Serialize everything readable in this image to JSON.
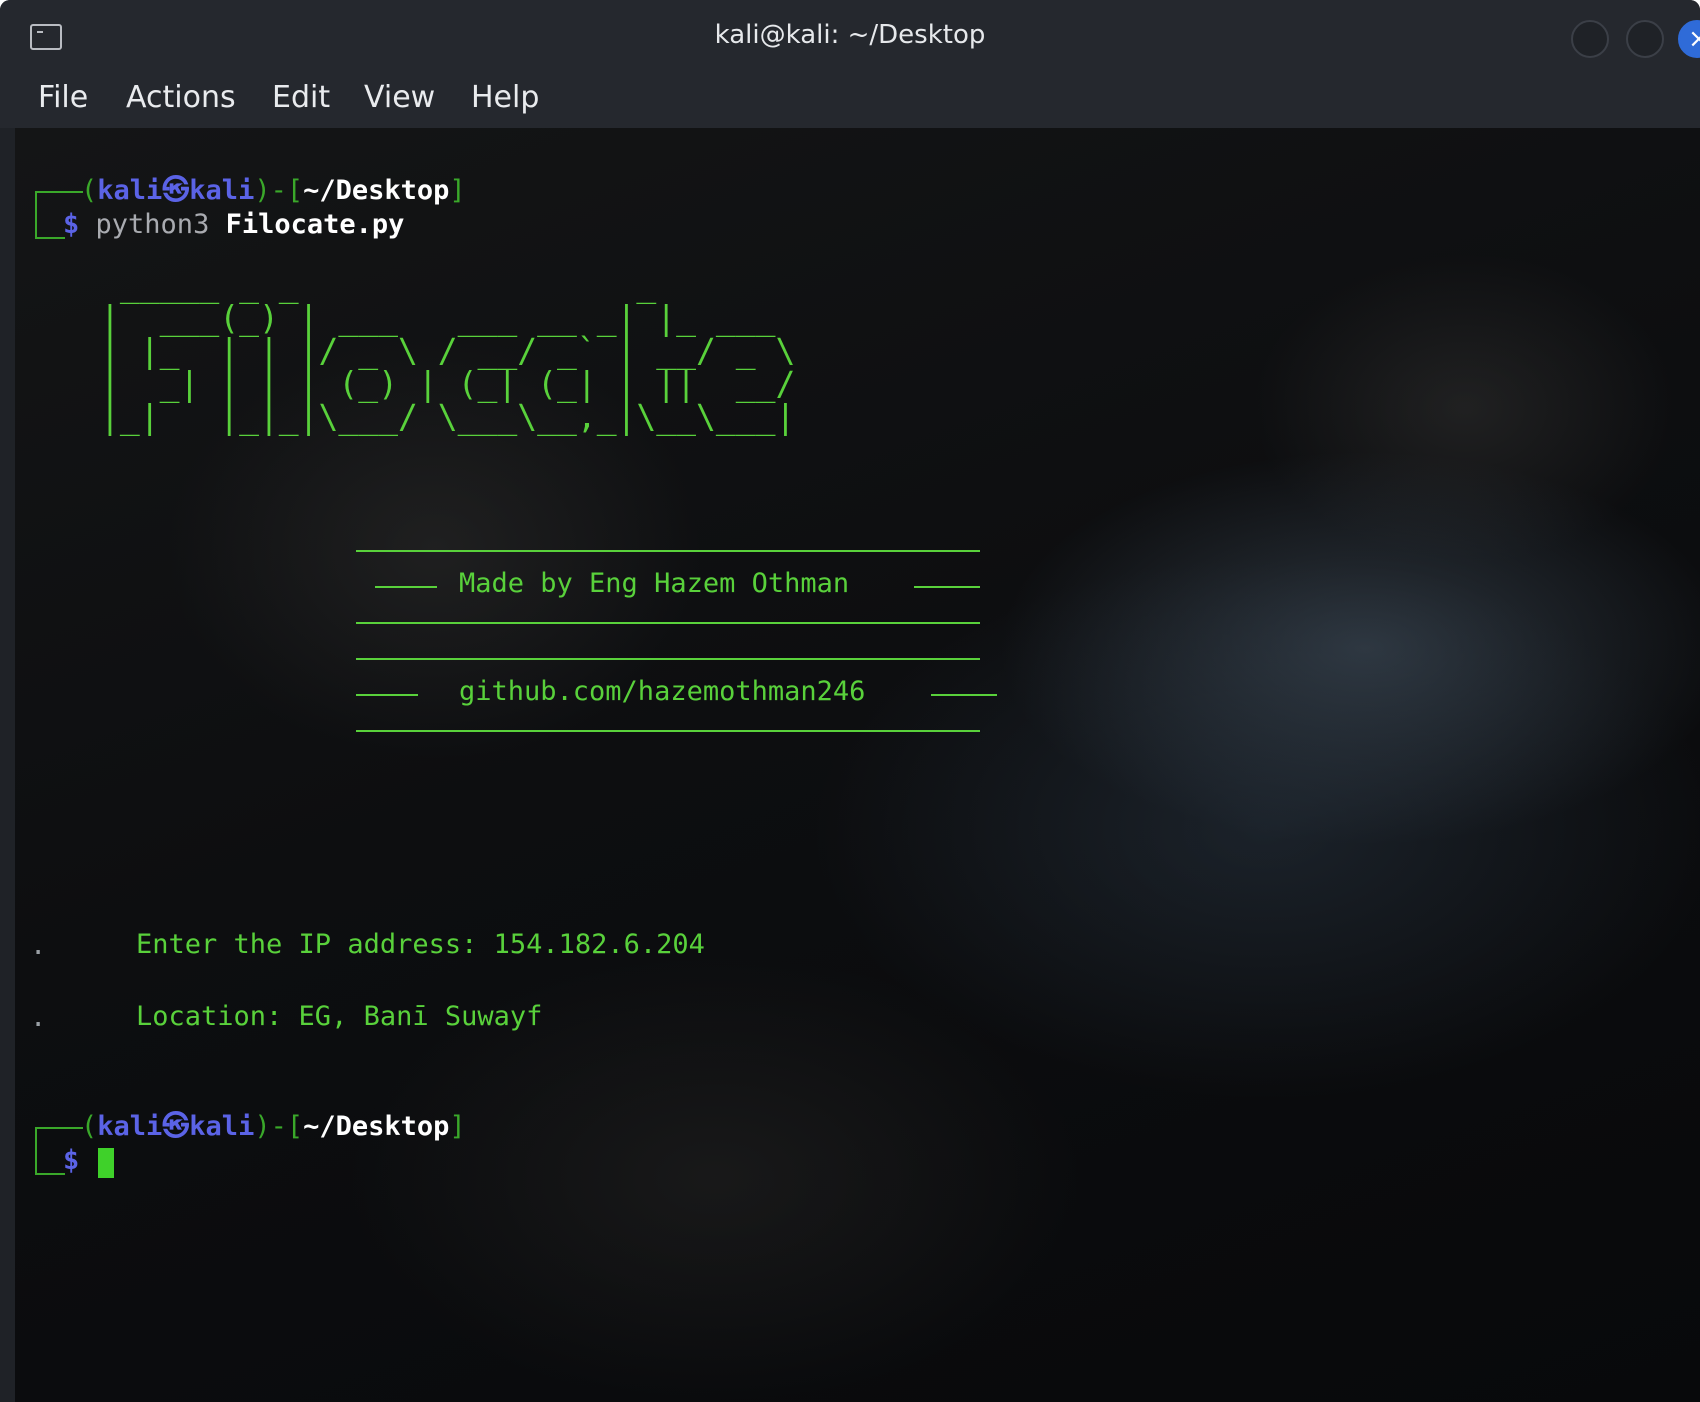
{
  "window": {
    "title": "kali@kali: ~/Desktop"
  },
  "menu": {
    "items": [
      "File",
      "Actions",
      "Edit",
      "View",
      "Help"
    ]
  },
  "prompt1": {
    "open": "(",
    "user": "kali",
    "at_symbol": "㉿",
    "host": "kali",
    "close": ")-[",
    "path": "~/Desktop",
    "end": "]",
    "dollar": "$",
    "command": "python3",
    "argument": "Filocate.py"
  },
  "banner": {
    "ascii_art": " _____ _ _                 _       \n|  ___(_) | ___   ___ __ _| |_ ___ \n| |_  | | |/ _ \\ / __/ _` | __/ _ \\\n|  _| | | | (_) | (_| (_| | ||  __/\n|_|   |_|_|\\___/ \\___\\__,_|\\__\\___|",
    "made_by": "Made by Eng Hazem Othman",
    "github": "github.com/hazemothman246"
  },
  "output": {
    "bullet": ".",
    "ip_prompt": "Enter the IP address: 154.182.6.204",
    "location": "Location: EG, Banī Suwayf"
  },
  "prompt2": {
    "open": "(",
    "user": "kali",
    "at_symbol": "㉿",
    "host": "kali",
    "close": ")-[",
    "path": "~/Desktop",
    "end": "]",
    "dollar": "$"
  },
  "colors": {
    "prompt_user": "#5b63e6",
    "prompt_accent": "#59d13b",
    "cursor": "#3fd12a"
  }
}
